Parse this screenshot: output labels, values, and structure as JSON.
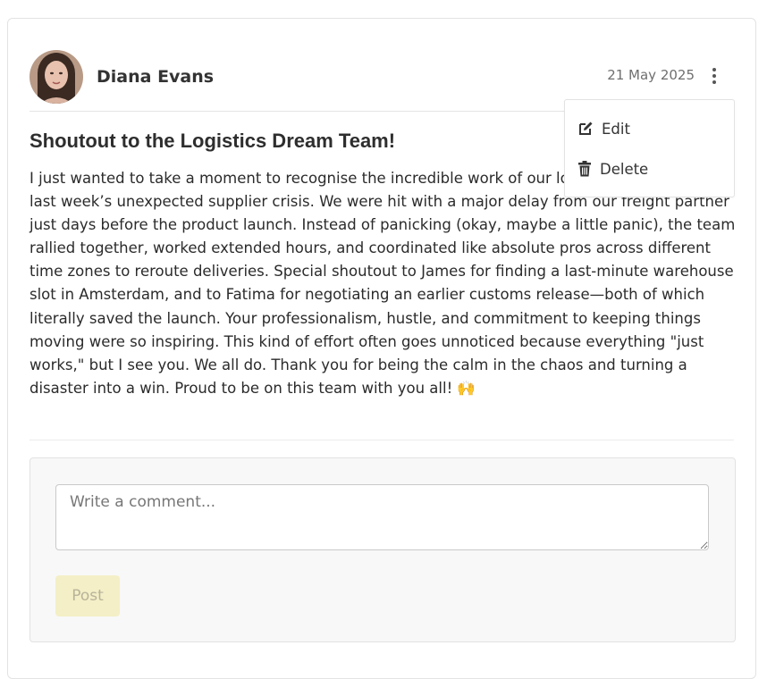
{
  "post": {
    "author": "Diana Evans",
    "date": "21 May 2025",
    "title": "Shoutout to the Logistics Dream Team!",
    "body": "I just wanted to take a moment to recognise the incredible work of our logistics team during last week’s unexpected supplier crisis. We were hit with a major delay from our freight partner just days before the product launch. Instead of panicking (okay, maybe a little panic), the team rallied together, worked extended hours, and coordinated like absolute pros across different time zones to reroute deliveries. Special shoutout to James for finding a last-minute warehouse slot in Amsterdam, and to Fatima for negotiating an earlier customs release—both of which literally saved the launch. Your professionalism, hustle, and commitment to keeping things moving were so inspiring. This kind of effort often goes unnoticed because everything \"just works,\" but I see you. We all do. Thank you for being the calm in the chaos and turning a disaster into a win. Proud to be on this team with you all! 🙌"
  },
  "menu": {
    "items": [
      {
        "label": "Edit",
        "icon": "edit-icon"
      },
      {
        "label": "Delete",
        "icon": "trash-icon"
      }
    ]
  },
  "comment": {
    "placeholder": "Write a comment...",
    "value": "",
    "post_label": "Post"
  },
  "colors": {
    "post_button_bg": "#f4efc6",
    "post_button_text": "#b8b39a"
  }
}
